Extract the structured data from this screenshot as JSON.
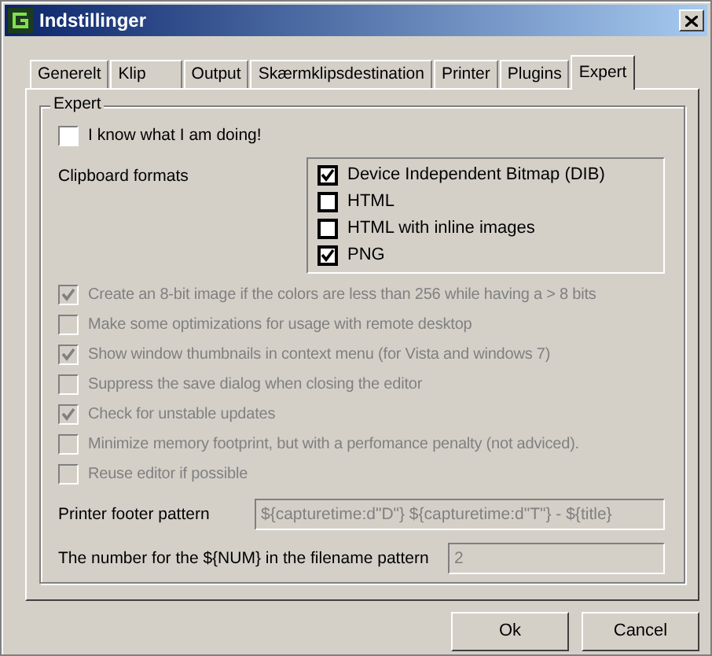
{
  "window": {
    "title": "Indstillinger"
  },
  "tabs": [
    {
      "label": "Generelt",
      "selected": false
    },
    {
      "label": "Klip",
      "selected": false
    },
    {
      "label": "Output",
      "selected": false
    },
    {
      "label": "Skærmklipsdestination",
      "selected": false
    },
    {
      "label": "Printer",
      "selected": false
    },
    {
      "label": "Plugins",
      "selected": false
    },
    {
      "label": "Expert",
      "selected": true
    }
  ],
  "group": {
    "title": "Expert",
    "know_checkbox": {
      "label": "I know what I am doing!",
      "checked": false
    },
    "clipboard_label": "Clipboard formats",
    "clipboard_formats": [
      {
        "label": "Device Independent Bitmap (DIB)",
        "checked": true
      },
      {
        "label": "HTML",
        "checked": false
      },
      {
        "label": "HTML with inline images",
        "checked": false
      },
      {
        "label": "PNG",
        "checked": true
      }
    ],
    "options": [
      {
        "label": "Create an 8-bit image if the colors are less than 256 while having a > 8 bits",
        "checked": true,
        "disabled": true
      },
      {
        "label": "Make some optimizations for usage with remote desktop",
        "checked": false,
        "disabled": true
      },
      {
        "label": "Show window thumbnails in context menu (for Vista and windows 7)",
        "checked": true,
        "disabled": true
      },
      {
        "label": "Suppress the save dialog when closing the editor",
        "checked": false,
        "disabled": true
      },
      {
        "label": "Check for unstable updates",
        "checked": true,
        "disabled": true
      },
      {
        "label": "Minimize memory footprint, but with a perfomance penalty (not adviced).",
        "checked": false,
        "disabled": true
      },
      {
        "label": "Reuse editor if possible",
        "checked": false,
        "disabled": true
      }
    ],
    "fields": [
      {
        "label": "Printer footer pattern",
        "value": "${capturetime:d\"D\"} ${capturetime:d\"T\"} - ${title}",
        "disabled": true
      },
      {
        "label": "The number for the ${NUM} in the filename pattern",
        "value": "2",
        "disabled": true
      }
    ]
  },
  "buttons": [
    "Ok",
    "Cancel"
  ]
}
